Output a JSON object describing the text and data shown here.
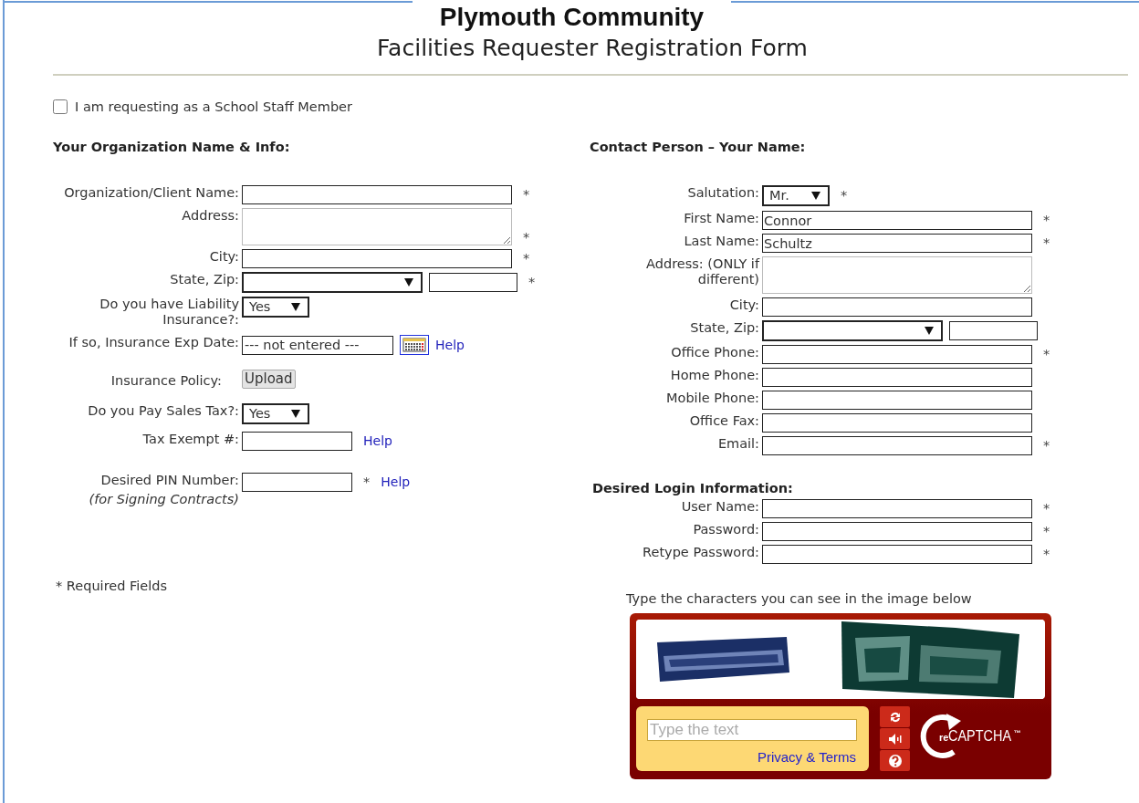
{
  "header": {
    "title": "Plymouth Community",
    "subtitle": "Facilities Requester Registration Form"
  },
  "staff_checkbox": {
    "label": "I am requesting as a School Staff Member",
    "checked": false
  },
  "organization": {
    "heading": "Your Organization Name & Info:",
    "fields": [
      {
        "label": "Organization/Client Name:",
        "kind": "text",
        "required_mark": "*"
      },
      {
        "label": "Address:",
        "kind": "textarea",
        "required_mark": "*"
      },
      {
        "label": "City:",
        "kind": "text",
        "required_mark": "*"
      },
      {
        "label": "State, Zip:",
        "kind": "state_zip",
        "required_mark": "*"
      },
      {
        "label": "Do you have Liability Insurance?:",
        "kind": "select",
        "value": "Yes"
      },
      {
        "label": "If so, Insurance Exp Date:",
        "kind": "date",
        "value": "--- not entered ---",
        "help": "Help"
      },
      {
        "label": "Insurance Policy:",
        "kind": "upload",
        "value": "Upload"
      },
      {
        "label": "Do you Pay Sales Tax?:",
        "kind": "select",
        "value": "Yes"
      },
      {
        "label": "Tax Exempt #:",
        "kind": "short_text",
        "help": "Help"
      },
      {
        "label": "Desired PIN Number:",
        "kind": "short_text",
        "required_mark": "*",
        "help": "Help",
        "sublabel": "(for Signing Contracts)"
      }
    ],
    "required_note": "* Required Fields"
  },
  "contact": {
    "heading": "Contact Person – Your Name:",
    "fields": [
      {
        "label": "Salutation:",
        "kind": "select",
        "value": "Mr.",
        "required_mark": "*"
      },
      {
        "label": "First Name:",
        "kind": "text",
        "value": "Connor",
        "required_mark": "*"
      },
      {
        "label": "Last Name:",
        "kind": "text",
        "value": "Schultz",
        "required_mark": "*"
      },
      {
        "label": "Address: (ONLY if different)",
        "kind": "textarea"
      },
      {
        "label": "City:",
        "kind": "text"
      },
      {
        "label": "State, Zip:",
        "kind": "state_zip"
      },
      {
        "label": "Office Phone:",
        "kind": "text",
        "required_mark": "*"
      },
      {
        "label": "Home Phone:",
        "kind": "text"
      },
      {
        "label": "Mobile Phone:",
        "kind": "text"
      },
      {
        "label": "Office Fax:",
        "kind": "text"
      },
      {
        "label": "Email:",
        "kind": "text",
        "required_mark": "*"
      }
    ]
  },
  "login": {
    "heading": "Desired Login Information:",
    "fields": [
      {
        "label": "User Name:",
        "kind": "text",
        "required_mark": "*"
      },
      {
        "label": "Password:",
        "kind": "text",
        "required_mark": "*"
      },
      {
        "label": "Retype Password:",
        "kind": "text",
        "required_mark": "*"
      }
    ]
  },
  "captcha": {
    "instruction": "Type the characters you can see in the image below",
    "placeholder": "Type the text",
    "link": "Privacy & Terms",
    "logo": {
      "prefix": "re",
      "name": "CAPTCHA",
      "mark": "™"
    }
  }
}
